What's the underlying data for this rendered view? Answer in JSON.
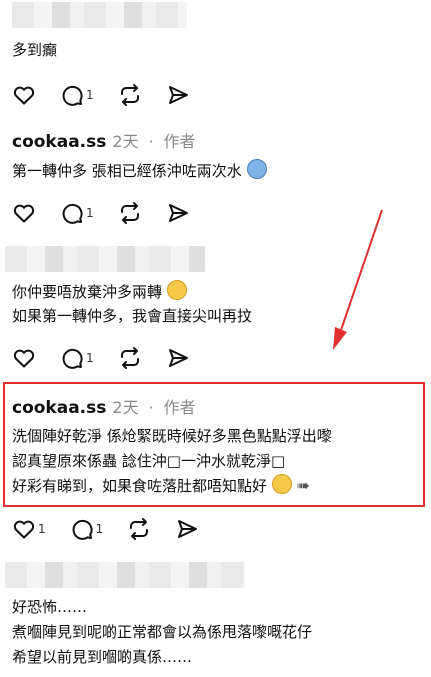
{
  "c1": {
    "text": "多到癲",
    "reply_count": "1"
  },
  "c2": {
    "username": "cookaa.ss",
    "time": "2天",
    "sep": "·",
    "author_tag": "作者",
    "line1": "第一轉仲多 張相已經係沖咗兩次水",
    "emoji": "cold-face-emoji",
    "reply_count": "1"
  },
  "c3": {
    "line1": "你仲要唔放棄沖多兩轉",
    "line1_emoji": "grinning-sweat-emoji",
    "line2": "如果第一轉仲多，我會直接尖叫再抆",
    "reply_count": "1"
  },
  "c4": {
    "username": "cookaa.ss",
    "time": "2天",
    "sep": "·",
    "author_tag": "作者",
    "line1": "洗個陣好乾淨 係炝緊既時候好多黑色點點浮出嚟",
    "line2": "認真望原來係蟲 諗住沖□一沖水就乾淨□",
    "line3": "好彩有睇到，如果食咗落肚都唔知點好",
    "like_count": "1",
    "reply_count": "1"
  },
  "c5": {
    "line1": "好恐怖……",
    "line2": "煮嗰陣見到呢啲正常都會以為係甩落嚟嘅花仔",
    "line3": "希望以前見到嗰啲真係……"
  },
  "colors": {
    "highlight": "#e03030",
    "meta": "#8a8a8a"
  }
}
